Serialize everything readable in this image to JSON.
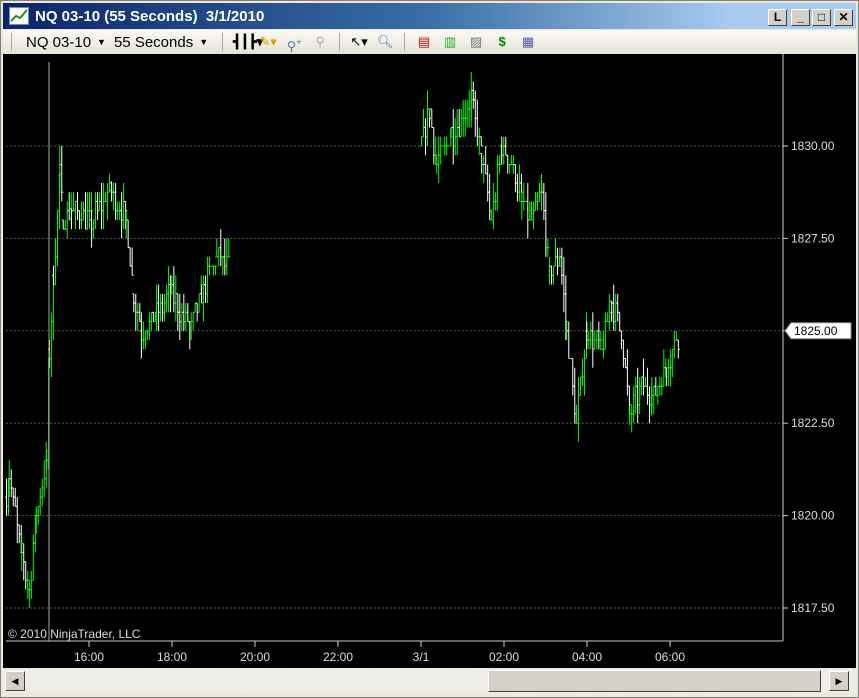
{
  "window": {
    "title": "NQ 03-10 (55 Seconds)  3/1/2010",
    "buttons": {
      "link": "L",
      "minimize": "_",
      "maximize": "□",
      "close": "✕"
    }
  },
  "toolbar": {
    "instrument": "NQ 03-10",
    "interval": "55 Seconds",
    "icons": [
      "bar-style-icon",
      "pencil-drawing-icon",
      "zoom-in-icon",
      "zoom-out-icon",
      "cursor-icon",
      "magnifier-icon",
      "indicators-icon",
      "strategies-icon",
      "chart-properties-icon",
      "dollar-orders-icon",
      "data-box-icon"
    ]
  },
  "chart": {
    "copyright": "© 2010 NinjaTrader, LLC",
    "price_ticks": [
      "1830.00",
      "1827.50",
      "1825.00",
      "1822.50",
      "1820.00",
      "1817.50"
    ],
    "price_values": [
      1830,
      1827.5,
      1825,
      1822.5,
      1820,
      1817.5
    ],
    "time_ticks": [
      "16:00",
      "18:00",
      "20:00",
      "22:00",
      "3/1",
      "02:00",
      "04:00",
      "06:00"
    ],
    "time_hours": [
      16,
      18,
      20,
      22,
      24,
      26,
      28,
      30
    ],
    "last_price": "1825.00",
    "colors": {
      "up": "#00ff00",
      "down": "#ffffff",
      "background": "#000000",
      "grid": "#555555"
    },
    "price_path": [
      [
        "2/28 14:00",
        1820.5
      ],
      [
        "2/28 14:04",
        1821
      ],
      [
        "2/28 14:22",
        1819
      ],
      [
        "2/28 14:33",
        1818
      ],
      [
        "2/28 14:43",
        1820
      ],
      [
        "2/28 14:58",
        1821.5
      ],
      [
        "2/28 15:02",
        1824.5
      ],
      [
        "2/28 15:08",
        1826.5
      ],
      [
        "2/28 15:17",
        1829.2
      ],
      [
        "2/28 15:22",
        1828
      ],
      [
        "2/28 15:34",
        1828.3
      ],
      [
        "2/28 16:03",
        1828
      ],
      [
        "2/28 16:32",
        1828.8
      ],
      [
        "2/28 16:53",
        1828
      ],
      [
        "2/28 17:04",
        1826
      ],
      [
        "2/28 17:15",
        1825
      ],
      [
        "2/28 17:37",
        1825.5
      ],
      [
        "2/28 17:59",
        1826
      ],
      [
        "2/28 18:27",
        1825
      ],
      [
        "2/28 18:42",
        1826
      ],
      [
        "2/28 19:04",
        1827
      ],
      [
        "2/28 19:22",
        1826.8
      ],
      null,
      [
        "3/1 00:00",
        1830
      ],
      [
        "3/1 00:12",
        1831
      ],
      [
        "3/1 00:22",
        1829.5
      ],
      [
        "3/1 00:43",
        1830.3
      ],
      [
        "3/1 01:12",
        1831.2
      ],
      [
        "3/1 01:27",
        1829.8
      ],
      [
        "3/1 01:41",
        1828
      ],
      [
        "3/1 01:56",
        1830
      ],
      [
        "3/1 02:10",
        1829.5
      ],
      [
        "3/1 02:25",
        1828.5
      ],
      [
        "3/1 02:39",
        1828
      ],
      [
        "3/1 02:54",
        1828.7
      ],
      [
        "3/1 03:05",
        1826.5
      ],
      [
        "3/1 03:20",
        1827
      ],
      [
        "3/1 03:30",
        1825
      ],
      [
        "3/1 03:44",
        1822.5
      ],
      [
        "3/1 03:59",
        1825
      ],
      [
        "3/1 04:20",
        1824.5
      ],
      [
        "3/1 04:35",
        1825.8
      ],
      [
        "3/1 04:49",
        1825
      ],
      [
        "3/1 05:01",
        1822.7
      ],
      [
        "3/1 05:18",
        1823.5
      ],
      [
        "3/1 05:33",
        1823.2
      ],
      [
        "3/1 05:54",
        1824
      ],
      [
        "3/1 06:13",
        1825
      ]
    ]
  }
}
